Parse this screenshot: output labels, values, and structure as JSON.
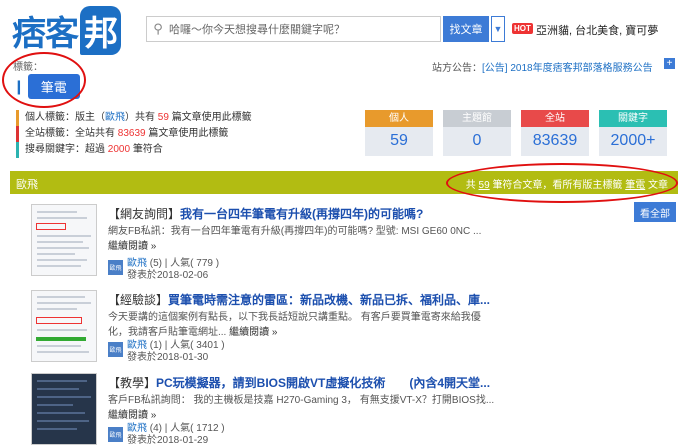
{
  "header": {
    "logo_text": "痞客",
    "logo_bubble": "邦",
    "search_placeholder": "哈囉～你今天想搜尋什麼關鍵字呢？",
    "search_button": "找文章",
    "dropdown_icon": "chevron-down",
    "hot_badge": "HOT",
    "hot_links": "亞洲貓, 台北美食, 寶可夢"
  },
  "tag": {
    "label": "標籤：",
    "name": "筆電"
  },
  "notice": {
    "prefix": "站方公告：",
    "link": "[公告] 2018年度痞客邦部落格服務公告",
    "plus": "+"
  },
  "info": {
    "row1_a": "個人標籤：版主（",
    "row1_author": "歐飛",
    "row1_b": "）共有",
    "row1_num": "59",
    "row1_c": "篇文章使用此標籤",
    "row2_a": "全站標籤：全站共有",
    "row2_num": "83639",
    "row2_c": "篇文章使用此標籤",
    "row3_a": "搜尋關鍵字：超過",
    "row3_num": "2000",
    "row3_c": "筆符合"
  },
  "stats": [
    {
      "label": "個人",
      "value": "59",
      "color": "#e89a2c"
    },
    {
      "label": "主題館",
      "value": "0",
      "color": "#c8cdd3"
    },
    {
      "label": "全站",
      "value": "83639",
      "color": "#e84a4a"
    },
    {
      "label": "關鍵字",
      "value": "2000+",
      "color": "#2bbfb3"
    }
  ],
  "bar": {
    "left": "歐飛",
    "right_a": "共",
    "right_num": "59",
    "right_b": "筆符合文章，看所有版主標籤",
    "right_tag": "筆電",
    "right_c": "文章"
  },
  "see_all": "看全部",
  "articles": [
    {
      "bracket": "【網友詢問】",
      "title": "我有一台四年筆電有升級(再撐四年)的可能嗎?",
      "excerpt1": "網友FB私訊：我有一台四年筆電有升級(再撐四年)的可能嗎? 型號: MSI GE60 0NC ...",
      "more": "繼續閱讀 »",
      "avatar": "歐飛",
      "author": "歐飛",
      "count": "(5)",
      "pop": "人氣( 779 )",
      "date": "發表於2018-02-06"
    },
    {
      "bracket": "【經驗談】",
      "title": "買筆電時需注意的雷區：新品改機、新品已拆、福利品、庫...",
      "excerpt1": "今天要講的這個案例有點長，以下我長話短說只講重點。 有客戶要買筆電寄來給我優",
      "excerpt2": "化，我請客戶貼筆電網址...",
      "more": "繼續閱讀 »",
      "avatar": "歐飛",
      "author": "歐飛",
      "count": "(1)",
      "pop": "人氣( 3401 )",
      "date": "發表於2018-01-30"
    },
    {
      "bracket": "【教學】",
      "title": "PC玩模擬器，請到BIOS開啟VT虛擬化技術　　(內含4開天堂...",
      "excerpt1": "客戶FB私訊詢問： 我的主機板是技嘉 H270-Gaming 3， 有無支援VT-X？打開BIOS找...",
      "more": "繼續閱讀 »",
      "avatar": "歐飛",
      "author": "歐飛",
      "count": "(4)",
      "pop": "人氣( 1712 )",
      "date": "發表於2018-01-29"
    }
  ],
  "icons": {
    "search": "search-icon",
    "tag": "tag-icon"
  }
}
